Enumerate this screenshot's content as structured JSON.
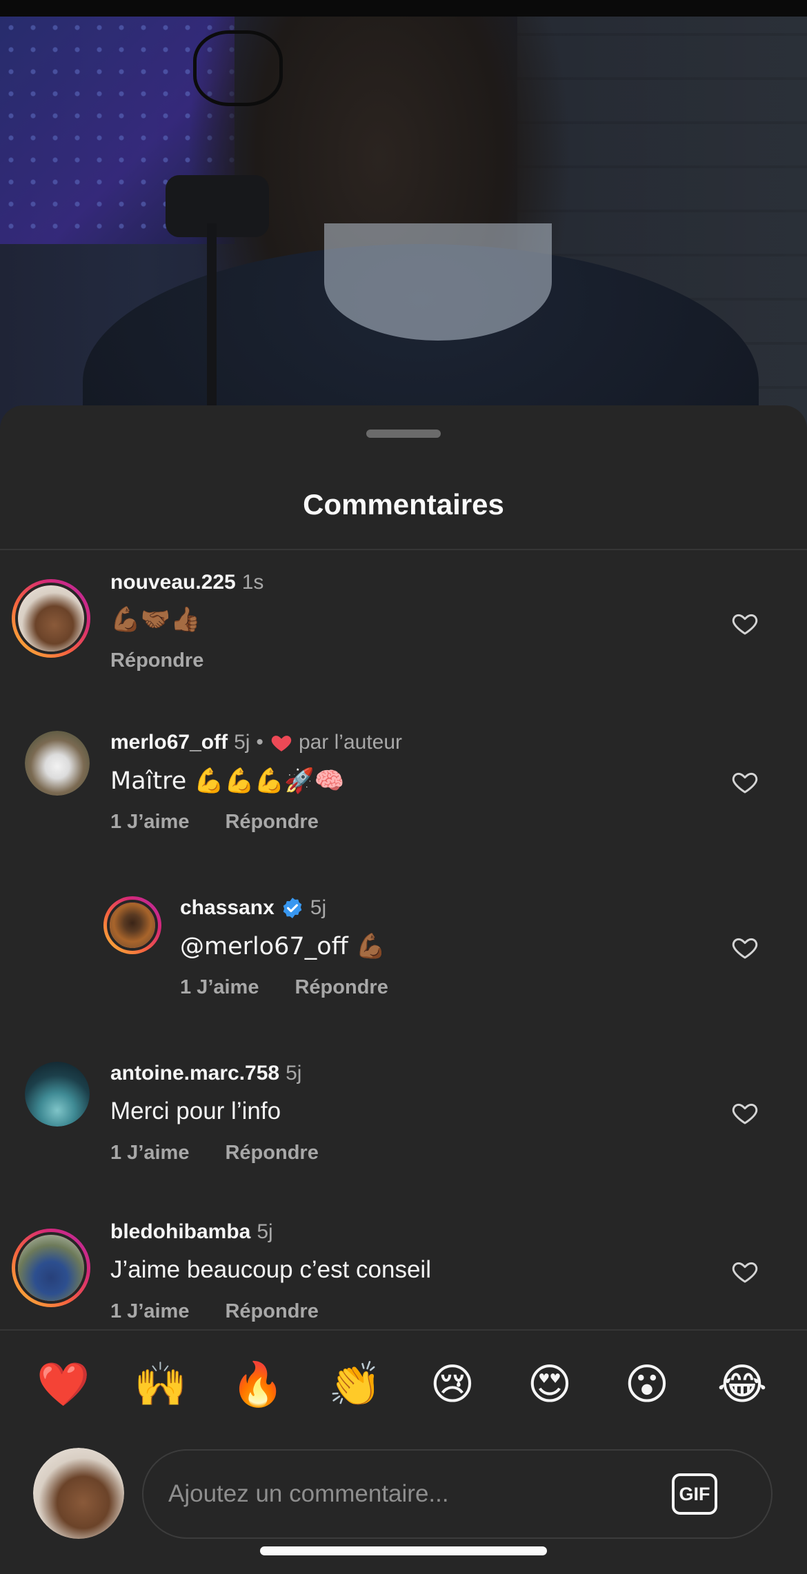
{
  "sheet": {
    "title": "Commentaires"
  },
  "comments": [
    {
      "username": "nouveau.225",
      "time": "1s",
      "text": "💪🏾🤝🏾👍🏾",
      "reply_label": "Répondre",
      "likes_label": ""
    },
    {
      "username": "merlo67_off",
      "time": "5j",
      "separator": "•",
      "byauthor_label": "par l’auteur",
      "text": "Maître 💪💪💪🚀🧠",
      "likes_label": "1 J’aime",
      "reply_label": "Répondre"
    },
    {
      "username": "chassanx",
      "verified": true,
      "time": "5j",
      "text": "@merlo67_off 💪🏾",
      "likes_label": "1 J’aime",
      "reply_label": "Répondre"
    },
    {
      "username": "antoine.marc.758",
      "time": "5j",
      "text": "Merci pour l’info",
      "likes_label": "1 J’aime",
      "reply_label": "Répondre"
    },
    {
      "username": "bledohibamba",
      "time": "5j",
      "text": "J’aime beaucoup c’est conseil",
      "likes_label": "1 J’aime",
      "reply_label": "Répondre"
    }
  ],
  "reactions": [
    "❤️",
    "🙌",
    "🔥",
    "👏",
    "😢",
    "😍",
    "😮",
    "😂"
  ],
  "composer": {
    "placeholder": "Ajoutez un commentaire...",
    "gif_label": "GIF"
  },
  "colors": {
    "sheet_bg": "#262626",
    "secondary_text": "#a8a8a8",
    "heart_red": "#ed4956",
    "verified_blue": "#3897f0"
  }
}
